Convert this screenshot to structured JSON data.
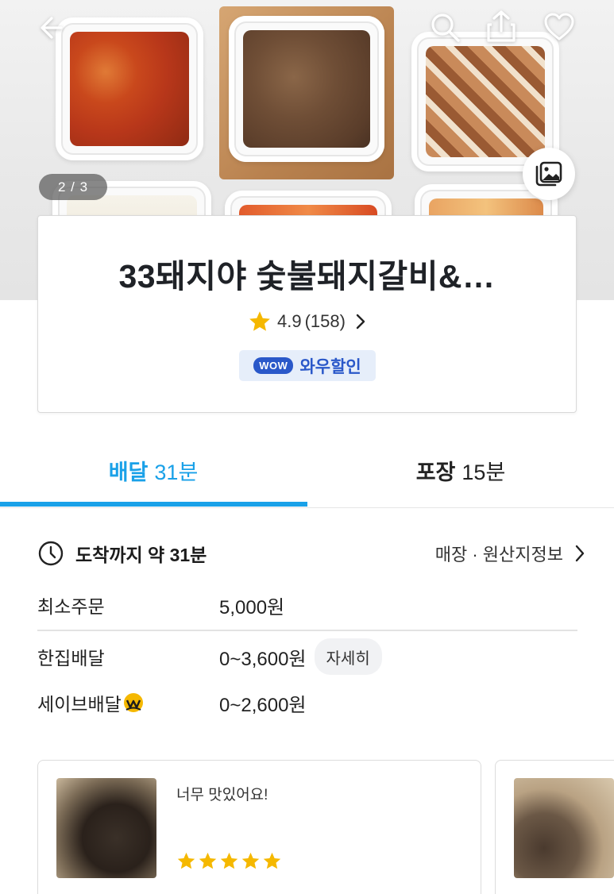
{
  "hero": {
    "page_indicator": "2 / 3"
  },
  "store": {
    "name": "33돼지야 숯불돼지갈비&…",
    "rating": "4.9",
    "review_count": "(158)",
    "wow_pill": "WOW",
    "wow_label": "와우할인"
  },
  "tabs": [
    {
      "name": "배달",
      "time": "31분",
      "active": true
    },
    {
      "name": "포장",
      "time": "15분",
      "active": false
    }
  ],
  "delivery": {
    "arrival": "도착까지 약 31분",
    "store_info_link": "매장 · 원산지정보",
    "min_order_label": "최소주문",
    "min_order_value": "5,000원",
    "home_delivery_label": "한집배달",
    "home_delivery_value": "0~3,600원",
    "detail_button": "자세히",
    "save_delivery_label": "세이브배달",
    "save_delivery_value": "0~2,600원"
  },
  "reviews": [
    {
      "text": "너무 맛있어요!",
      "stars": 5
    }
  ],
  "colors": {
    "accent": "#1aa1e8",
    "wow_blue": "#2a58c9",
    "star": "#f5b800",
    "save_badge": "#f5b800"
  }
}
